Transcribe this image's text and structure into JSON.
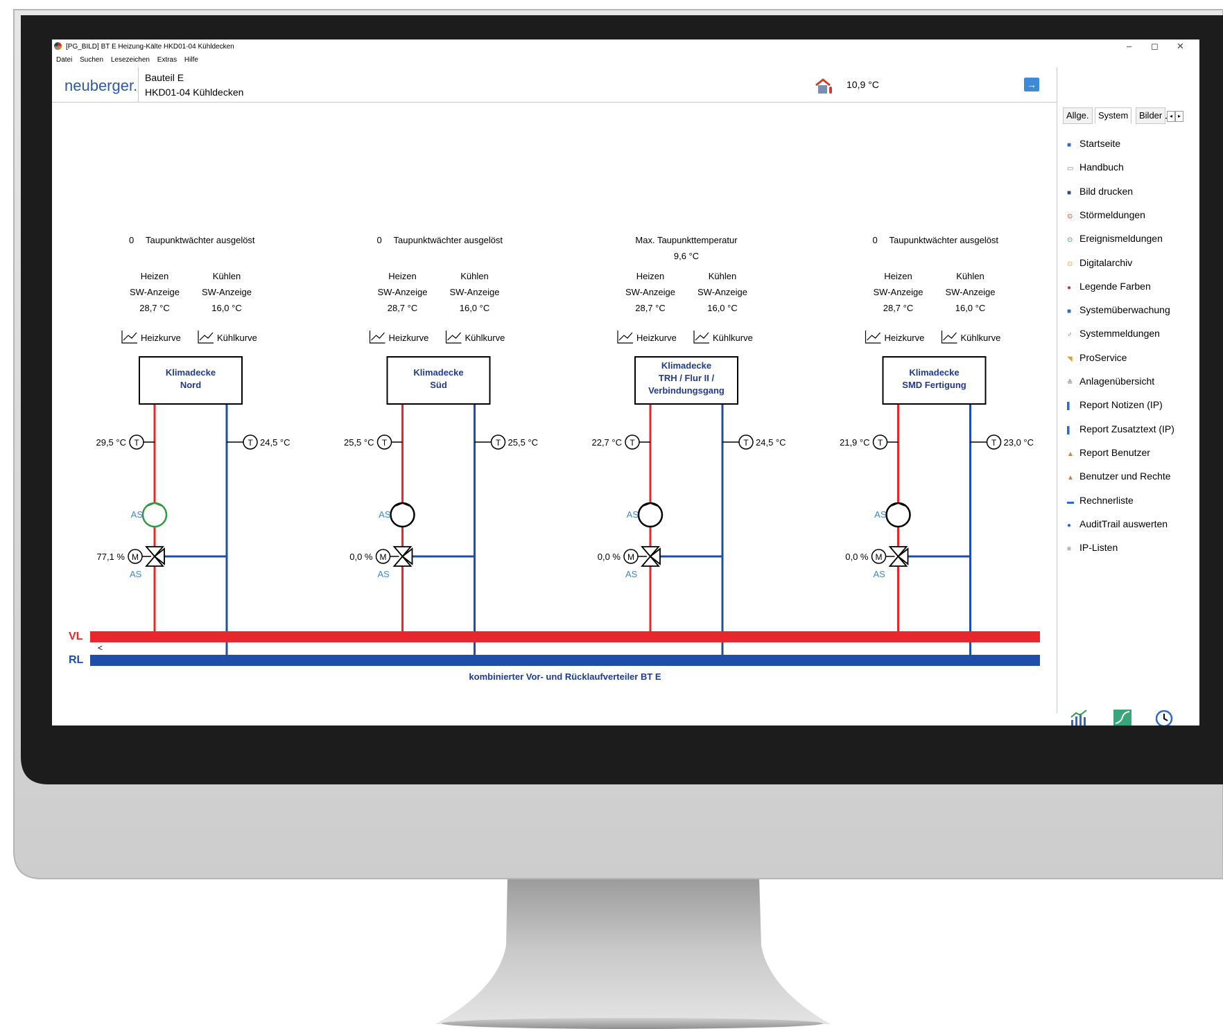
{
  "window": {
    "title": "[PG_BILD] BT E Heizung-Kälte HKD01-04 Kühldecken",
    "controls": {
      "minimize": "–",
      "maximize": "◻",
      "close": "✕"
    }
  },
  "menu": [
    "Datei",
    "Suchen",
    "Lesezeichen",
    "Extras",
    "Hilfe"
  ],
  "header": {
    "logo": "neuberger.",
    "breadcrumb_1": "Bauteil E",
    "breadcrumb_2": "HKD01-04 Kühldecken",
    "outdoor_temp": "10,9 °C",
    "next_symbol": "→"
  },
  "nav": {
    "back": "←",
    "up": "↑",
    "forward": "→"
  },
  "sidebar": {
    "tabs": [
      "Allge.",
      "System",
      "Bilder"
    ],
    "active_tab": "System",
    "items": [
      {
        "label": "Startseite",
        "icon": "home-icon",
        "color": "#2e6bc6",
        "glyph": "■"
      },
      {
        "label": "Handbuch",
        "icon": "book-icon",
        "color": "#6b7fa8",
        "glyph": "▭"
      },
      {
        "label": "Bild drucken",
        "icon": "printer-icon",
        "color": "#334a7a",
        "glyph": "■"
      },
      {
        "label": "Störmeldungen",
        "icon": "alarm-icon",
        "color": "#d23a2c",
        "glyph": "⊙"
      },
      {
        "label": "Ereignismeldungen",
        "icon": "event-icon",
        "color": "#2e9b4b",
        "glyph": "⊙"
      },
      {
        "label": "Digitalarchiv",
        "icon": "archive-icon",
        "color": "#e3a12c",
        "glyph": "⊙"
      },
      {
        "label": "Legende Farben",
        "icon": "palette-icon",
        "color": "#c0392b",
        "glyph": "●"
      },
      {
        "label": "Systemüberwachung",
        "icon": "monitor-icon",
        "color": "#2e6bc6",
        "glyph": "■"
      },
      {
        "label": "Systemmeldungen",
        "icon": "network-icon",
        "color": "#2e6bc6",
        "glyph": "♂"
      },
      {
        "label": "ProService",
        "icon": "service-icon",
        "color": "#e3a12c",
        "glyph": "◥"
      },
      {
        "label": "Anlagenübersicht",
        "icon": "plant-overview-icon",
        "color": "#555555",
        "glyph": "≗"
      },
      {
        "label": "Report Notizen (IP)",
        "icon": "report-notes-icon",
        "color": "#2e6bc6",
        "glyph": "▌"
      },
      {
        "label": "Report Zusatztext (IP)",
        "icon": "report-text-icon",
        "color": "#2e6bc6",
        "glyph": "▌"
      },
      {
        "label": "Report Benutzer",
        "icon": "report-user-icon",
        "color": "#e07b2c",
        "glyph": "▲"
      },
      {
        "label": "Benutzer und Rechte",
        "icon": "users-icon",
        "color": "#e07b2c",
        "glyph": "▲"
      },
      {
        "label": "Rechnerliste",
        "icon": "computer-list-icon",
        "color": "#2e6bc6",
        "glyph": "▬"
      },
      {
        "label": "AuditTrail auswerten",
        "icon": "shield-icon",
        "color": "#2e6bc6",
        "glyph": "●"
      },
      {
        "label": "IP-Listen",
        "icon": "list-icon",
        "color": "#2e6bc6",
        "glyph": "≡"
      }
    ],
    "bottom_icons": [
      "bar-chart-icon",
      "trend-icon",
      "clock-icon"
    ]
  },
  "circuits": [
    {
      "status_value": "0",
      "status_label": "Taupunktwächter ausgelöst",
      "heat_label": "Heizen",
      "cool_label": "Kühlen",
      "heat_sw": "SW-Anzeige",
      "cool_sw": "SW-Anzeige",
      "heat_setpoint": "28,7 °C",
      "cool_setpoint": "16,0 °C",
      "heat_curve": "Heizkurve",
      "cool_curve": "Kühlkurve",
      "name_lines": [
        "Klimadecke",
        "Nord"
      ],
      "supply_temp": "29,5 °C",
      "return_temp": "24,5 °C",
      "sensor_symbol": "T",
      "motor_symbol": "M",
      "pump_label": "AS",
      "pump_running": true,
      "valve_position": "77,1 %",
      "valve_label": "AS"
    },
    {
      "status_value": "0",
      "status_label": "Taupunktwächter ausgelöst",
      "heat_label": "Heizen",
      "cool_label": "Kühlen",
      "heat_sw": "SW-Anzeige",
      "cool_sw": "SW-Anzeige",
      "heat_setpoint": "28,7 °C",
      "cool_setpoint": "16,0 °C",
      "heat_curve": "Heizkurve",
      "cool_curve": "Kühlkurve",
      "name_lines": [
        "Klimadecke",
        "Süd"
      ],
      "supply_temp": "25,5 °C",
      "return_temp": "25,5 °C",
      "sensor_symbol": "T",
      "motor_symbol": "M",
      "pump_label": "AS",
      "pump_running": false,
      "valve_position": "0,0 %",
      "valve_label": "AS"
    },
    {
      "status_label_1": "Max. Taupunkttemperatur",
      "status_value_2": "9,6 °C",
      "heat_label": "Heizen",
      "cool_label": "Kühlen",
      "heat_sw": "SW-Anzeige",
      "cool_sw": "SW-Anzeige",
      "heat_setpoint": "28,7 °C",
      "cool_setpoint": "16,0 °C",
      "heat_curve": "Heizkurve",
      "cool_curve": "Kühlkurve",
      "name_lines": [
        "Klimadecke",
        "TRH / Flur II /",
        "Verbindungsgang"
      ],
      "supply_temp": "22,7 °C",
      "return_temp": "24,5 °C",
      "sensor_symbol": "T",
      "motor_symbol": "M",
      "pump_label": "AS",
      "pump_running": false,
      "valve_position": "0,0 %",
      "valve_label": "AS"
    },
    {
      "status_value": "0",
      "status_label": "Taupunktwächter ausgelöst",
      "heat_label": "Heizen",
      "cool_label": "Kühlen",
      "heat_sw": "SW-Anzeige",
      "cool_sw": "SW-Anzeige",
      "heat_setpoint": "28,7 °C",
      "cool_setpoint": "16,0 °C",
      "heat_curve": "Heizkurve",
      "cool_curve": "Kühlkurve",
      "name_lines": [
        "Klimadecke",
        "SMD Fertigung"
      ],
      "supply_temp": "21,9 °C",
      "return_temp": "23,0 °C",
      "sensor_symbol": "T",
      "motor_symbol": "M",
      "pump_label": "AS",
      "pump_running": false,
      "valve_position": "0,0 %",
      "valve_label": "AS"
    }
  ],
  "distributor": {
    "supply_label": "VL",
    "return_label": "RL",
    "arrow_symbol": "<",
    "caption": "kombinierter Vor- und Rücklaufverteiler BT E"
  },
  "colors": {
    "supply": "#e8262b",
    "return": "#1f4ea8",
    "pump_running": "#2e9b3f",
    "pump_stopped": "#000000",
    "label_blue": "#3f86c9",
    "box_text": "#1f3b8e",
    "screen_bezel": "#1c1c1c",
    "body_silver": "#d6d6d6"
  }
}
